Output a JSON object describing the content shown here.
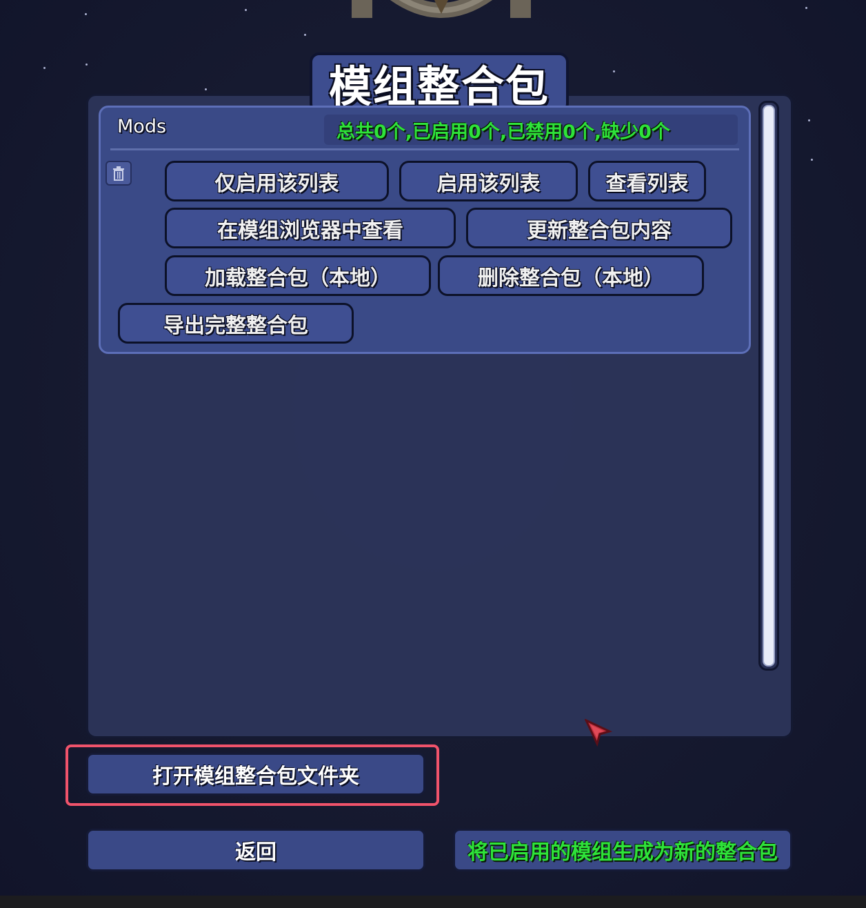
{
  "dialog": {
    "title": "模组整合包"
  },
  "modpack": {
    "name": "Mods",
    "stats": "总共0个,已启用0个,已禁用0个,缺少0个",
    "actions": {
      "enable_only": "仅启用该列表",
      "enable": "启用该列表",
      "view_list": "查看列表",
      "view_in_browser": "在模组浏览器中查看",
      "update_content": "更新整合包内容",
      "load_local": "加载整合包（本地）",
      "delete_local": "删除整合包（本地）",
      "export_full": "导出完整整合包"
    }
  },
  "footer": {
    "open_folder": "打开模组整合包文件夹",
    "back": "返回",
    "save_enabled_as_new": "将已启用的模组生成为新的整合包"
  },
  "colors": {
    "panel": "#2c3459",
    "button": "#3f4f92",
    "stats_text": "#2ee33a",
    "highlight": "#f0536b"
  }
}
